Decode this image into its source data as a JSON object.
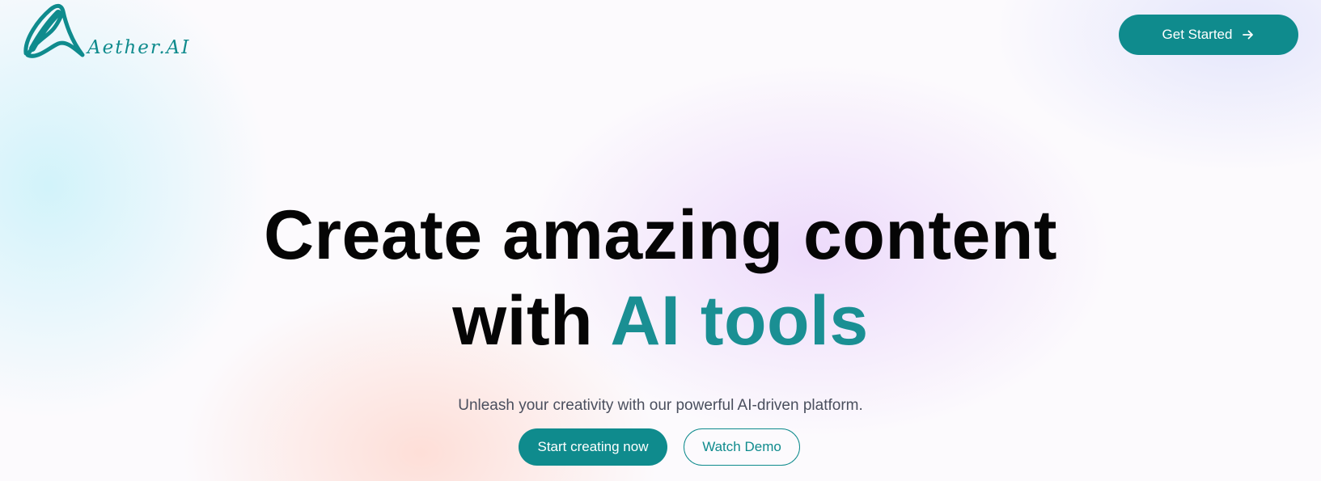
{
  "brand": {
    "name": "Aether.AI",
    "logo_icon": "swirl-a-logo-icon",
    "color": "#0f8b8d"
  },
  "header": {
    "cta_label": "Get Started",
    "cta_icon": "arrow-right-icon"
  },
  "hero": {
    "title_line1": "Create amazing content",
    "title_line2_prefix": "with",
    "title_line2_accent": "AI tools",
    "accent_color": "#1a8f93",
    "subtitle": "Unleash your creativity with our powerful AI-driven platform."
  },
  "actions": {
    "primary_label": "Start creating now",
    "secondary_label": "Watch Demo"
  }
}
